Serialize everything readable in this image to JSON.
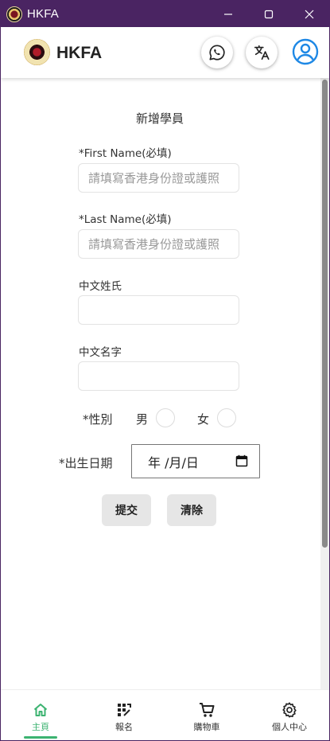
{
  "window": {
    "title": "HKFA"
  },
  "header": {
    "brand": "HKFA",
    "whatsapp_icon": "whatsapp-icon",
    "translate_icon": "translate-icon",
    "account_icon": "account-circle-icon"
  },
  "form": {
    "title": "新增學員",
    "first_name_label": "*First Name(必填)",
    "first_name_placeholder": "請填寫香港身份證或護照",
    "last_name_label": "*Last Name(必填)",
    "last_name_placeholder": "請填寫香港身份證或護照",
    "chinese_surname_label": "中文姓氏",
    "chinese_given_name_label": "中文名字",
    "gender_label": "*性別",
    "gender_male": "男",
    "gender_female": "女",
    "dob_label": "*出生日期",
    "dob_placeholder": "年 /月/日",
    "submit_label": "提交",
    "clear_label": "清除"
  },
  "nav": {
    "items": [
      {
        "label": "主頁",
        "icon": "home-icon",
        "active": true
      },
      {
        "label": "報名",
        "icon": "grid-icon",
        "active": false
      },
      {
        "label": "購物車",
        "icon": "cart-icon",
        "active": false
      },
      {
        "label": "個人中心",
        "icon": "settings-icon",
        "active": false
      }
    ]
  },
  "colors": {
    "titlebar": "#4a2462",
    "accent_green": "#3cb371",
    "avatar_blue": "#1e88e5"
  }
}
